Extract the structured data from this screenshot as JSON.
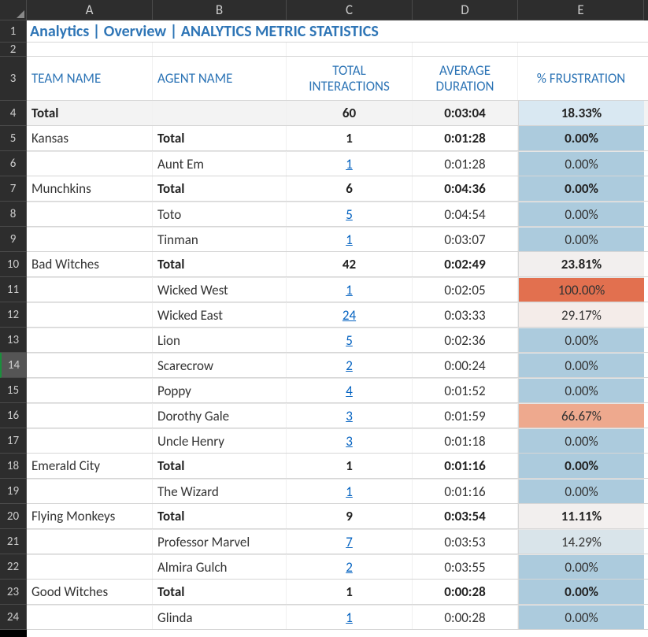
{
  "columns": [
    "A",
    "B",
    "C",
    "D",
    "E"
  ],
  "col_widths": {
    "A": 160,
    "B": 170,
    "C": 160,
    "D": 134,
    "E": 160
  },
  "row_numbers": [
    1,
    2,
    3,
    4,
    5,
    6,
    7,
    8,
    9,
    10,
    11,
    12,
    13,
    14,
    15,
    16,
    17,
    18,
    19,
    20,
    21,
    22,
    23,
    24
  ],
  "selected_row": 14,
  "title": "Analytics | Overview | ANALYTICS METRIC STATISTICS",
  "headers": {
    "team": "TEAM NAME",
    "agent": "AGENT NAME",
    "interactions": "TOTAL INTERACTIONS",
    "duration": "AVERAGE DURATION",
    "frustration": "% FRUSTRATION"
  },
  "grand_total": {
    "label": "Total",
    "interactions": "60",
    "duration": "0:03:04",
    "frustration": "18.33%",
    "frust_color": "#d9e8f2"
  },
  "teams": [
    {
      "name": "Kansas",
      "total": {
        "label": "Total",
        "interactions": "1",
        "duration": "0:01:28",
        "frustration": "0.00%",
        "frust_color": "#accbdd"
      },
      "agents": [
        {
          "name": "Aunt Em",
          "interactions": "1",
          "duration": "0:01:28",
          "frustration": "0.00%",
          "frust_color": "#accbdd"
        }
      ]
    },
    {
      "name": "Munchkins",
      "total": {
        "label": "Total",
        "interactions": "6",
        "duration": "0:04:36",
        "frustration": "0.00%",
        "frust_color": "#accbdd"
      },
      "agents": [
        {
          "name": "Toto",
          "interactions": "5",
          "duration": "0:04:54",
          "frustration": "0.00%",
          "frust_color": "#accbdd"
        },
        {
          "name": "Tinman",
          "interactions": "1",
          "duration": "0:03:07",
          "frustration": "0.00%",
          "frust_color": "#accbdd"
        }
      ]
    },
    {
      "name": "Bad Witches",
      "total": {
        "label": "Total",
        "interactions": "42",
        "duration": "0:02:49",
        "frustration": "23.81%",
        "frust_color": "#f2efee"
      },
      "agents": [
        {
          "name": "Wicked West",
          "interactions": "1",
          "duration": "0:02:05",
          "frustration": "100.00%",
          "frust_color": "#e2704f"
        },
        {
          "name": "Wicked East",
          "interactions": "24",
          "duration": "0:03:33",
          "frustration": "29.17%",
          "frust_color": "#f4ece9"
        },
        {
          "name": "Lion",
          "interactions": "5",
          "duration": "0:02:36",
          "frustration": "0.00%",
          "frust_color": "#accbdd"
        },
        {
          "name": "Scarecrow",
          "interactions": "2",
          "duration": "0:00:24",
          "frustration": "0.00%",
          "frust_color": "#accbdd"
        },
        {
          "name": "Poppy",
          "interactions": "4",
          "duration": "0:01:52",
          "frustration": "0.00%",
          "frust_color": "#accbdd"
        },
        {
          "name": "Dorothy Gale",
          "interactions": "3",
          "duration": "0:01:59",
          "frustration": "66.67%",
          "frust_color": "#eea98e"
        },
        {
          "name": "Uncle Henry",
          "interactions": "3",
          "duration": "0:01:18",
          "frustration": "0.00%",
          "frust_color": "#accbdd"
        }
      ]
    },
    {
      "name": "Emerald City",
      "total": {
        "label": "Total",
        "interactions": "1",
        "duration": "0:01:16",
        "frustration": "0.00%",
        "frust_color": "#accbdd"
      },
      "agents": [
        {
          "name": "The Wizard",
          "interactions": "1",
          "duration": "0:01:16",
          "frustration": "0.00%",
          "frust_color": "#accbdd"
        }
      ]
    },
    {
      "name": "Flying Monkeys",
      "total": {
        "label": "Total",
        "interactions": "9",
        "duration": "0:03:54",
        "frustration": "11.11%",
        "frust_color": "#f2efee"
      },
      "agents": [
        {
          "name": "Professor Marvel",
          "interactions": "7",
          "duration": "0:03:53",
          "frustration": "14.29%",
          "frust_color": "#d9e4ea"
        },
        {
          "name": "Almira Gulch",
          "interactions": "2",
          "duration": "0:03:55",
          "frustration": "0.00%",
          "frust_color": "#accbdd"
        }
      ]
    },
    {
      "name": "Good Witches",
      "total": {
        "label": "Total",
        "interactions": "1",
        "duration": "0:00:28",
        "frustration": "0.00%",
        "frust_color": "#accbdd"
      },
      "agents": [
        {
          "name": "Glinda",
          "interactions": "1",
          "duration": "0:00:28",
          "frustration": "0.00%",
          "frust_color": "#accbdd"
        }
      ]
    }
  ],
  "row_heights": {
    "1": 28,
    "2": 18,
    "3": 56,
    "default": 32
  }
}
